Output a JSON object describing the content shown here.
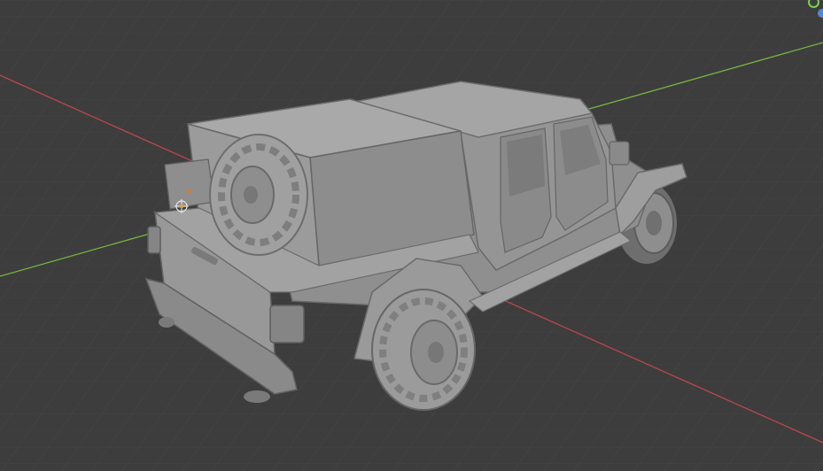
{
  "viewport": {
    "name": "3D Viewport",
    "background": "#3d3d3d",
    "shading": "solid",
    "object": "jeep-gladiator-pickup-mesh"
  },
  "axes": {
    "x_color": "#b9474d",
    "y_color": "#76b63f",
    "grid_color": "#4a4a4a"
  },
  "gizmo": {
    "y_color": "#7ad04a",
    "z_color": "#4f8bd6"
  },
  "icons": [
    "object-origin-icon",
    "light-empty-icon",
    "axis-gizmo-icon"
  ]
}
